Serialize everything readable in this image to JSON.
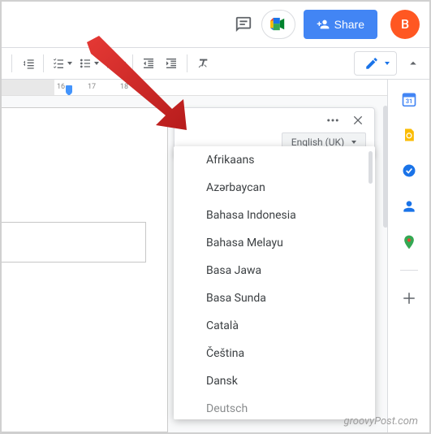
{
  "header": {
    "share_label": "Share",
    "avatar_letter": "B"
  },
  "ruler": {
    "n1": "16",
    "n2": "17",
    "n3": "18"
  },
  "popup": {
    "current_language": "English (UK)"
  },
  "languages": [
    "Afrikaans",
    "Azərbaycan",
    "Bahasa Indonesia",
    "Bahasa Melayu",
    "Basa Jawa",
    "Basa Sunda",
    "Català",
    "Čeština",
    "Dansk",
    "Deutsch"
  ],
  "watermark": "groovyPost.com"
}
